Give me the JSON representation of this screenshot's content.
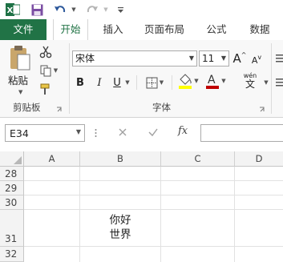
{
  "quick_access": {
    "icons": [
      "excel-logo-icon",
      "save-icon",
      "undo-icon",
      "redo-icon",
      "customize-icon"
    ]
  },
  "tabs": [
    {
      "label": "文件"
    },
    {
      "label": "开始"
    },
    {
      "label": "插入"
    },
    {
      "label": "页面布局"
    },
    {
      "label": "公式"
    },
    {
      "label": "数据"
    }
  ],
  "ribbon": {
    "clipboard": {
      "paste_label": "粘贴",
      "group_label": "剪贴板"
    },
    "font": {
      "font_name": "宋体",
      "font_size": "11",
      "increase_label": "A",
      "decrease_label": "A",
      "bold": "B",
      "italic": "I",
      "underline": "U",
      "font_color_glyph": "A",
      "phonetic_label": "wén",
      "phonetic_glyph": "文",
      "group_label": "字体"
    },
    "colors": {
      "accent": "#217346",
      "fill_yellow": "#ffff00",
      "font_red": "#c00000"
    }
  },
  "formula_bar": {
    "name_box": "E34",
    "fx": "fx",
    "formula": ""
  },
  "sheet": {
    "columns": [
      "A",
      "B",
      "C",
      "D"
    ],
    "rows": [
      "28",
      "29",
      "30",
      "31",
      "32"
    ],
    "cell_b31_line1": "你好",
    "cell_b31_line2": "世界"
  }
}
